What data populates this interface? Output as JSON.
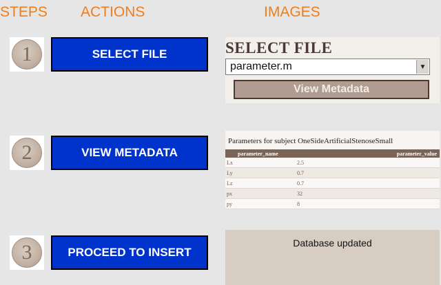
{
  "headers": {
    "steps": "STEPS",
    "actions": "ACTIONS",
    "images": "IMAGES"
  },
  "steps": [
    {
      "number": "1",
      "action_label": "SELECT FILE"
    },
    {
      "number": "2",
      "action_label": "VIEW METADATA"
    },
    {
      "number": "3",
      "action_label": "PROCEED TO INSERT"
    }
  ],
  "image1": {
    "title": "SELECT FILE",
    "select_value": "parameter.m",
    "arrow_icon": "chevron-down-icon",
    "button_label": "View Metadata"
  },
  "image2": {
    "title": "Parameters for subject OneSideArtificialStenoseSmall",
    "columns": [
      "parameter_name",
      "parameter_value"
    ],
    "rows": [
      {
        "name": "Lx",
        "value": "2.5"
      },
      {
        "name": "Ly",
        "value": "0.7"
      },
      {
        "name": "Lz",
        "value": "0.7"
      },
      {
        "name": "px",
        "value": "32"
      },
      {
        "name": "py",
        "value": "8"
      }
    ]
  },
  "image3": {
    "message": "Database updated"
  },
  "colors": {
    "header_orange": "#f07d1c",
    "button_blue": "#0033cc",
    "page_bg": "#e6e6e6"
  }
}
